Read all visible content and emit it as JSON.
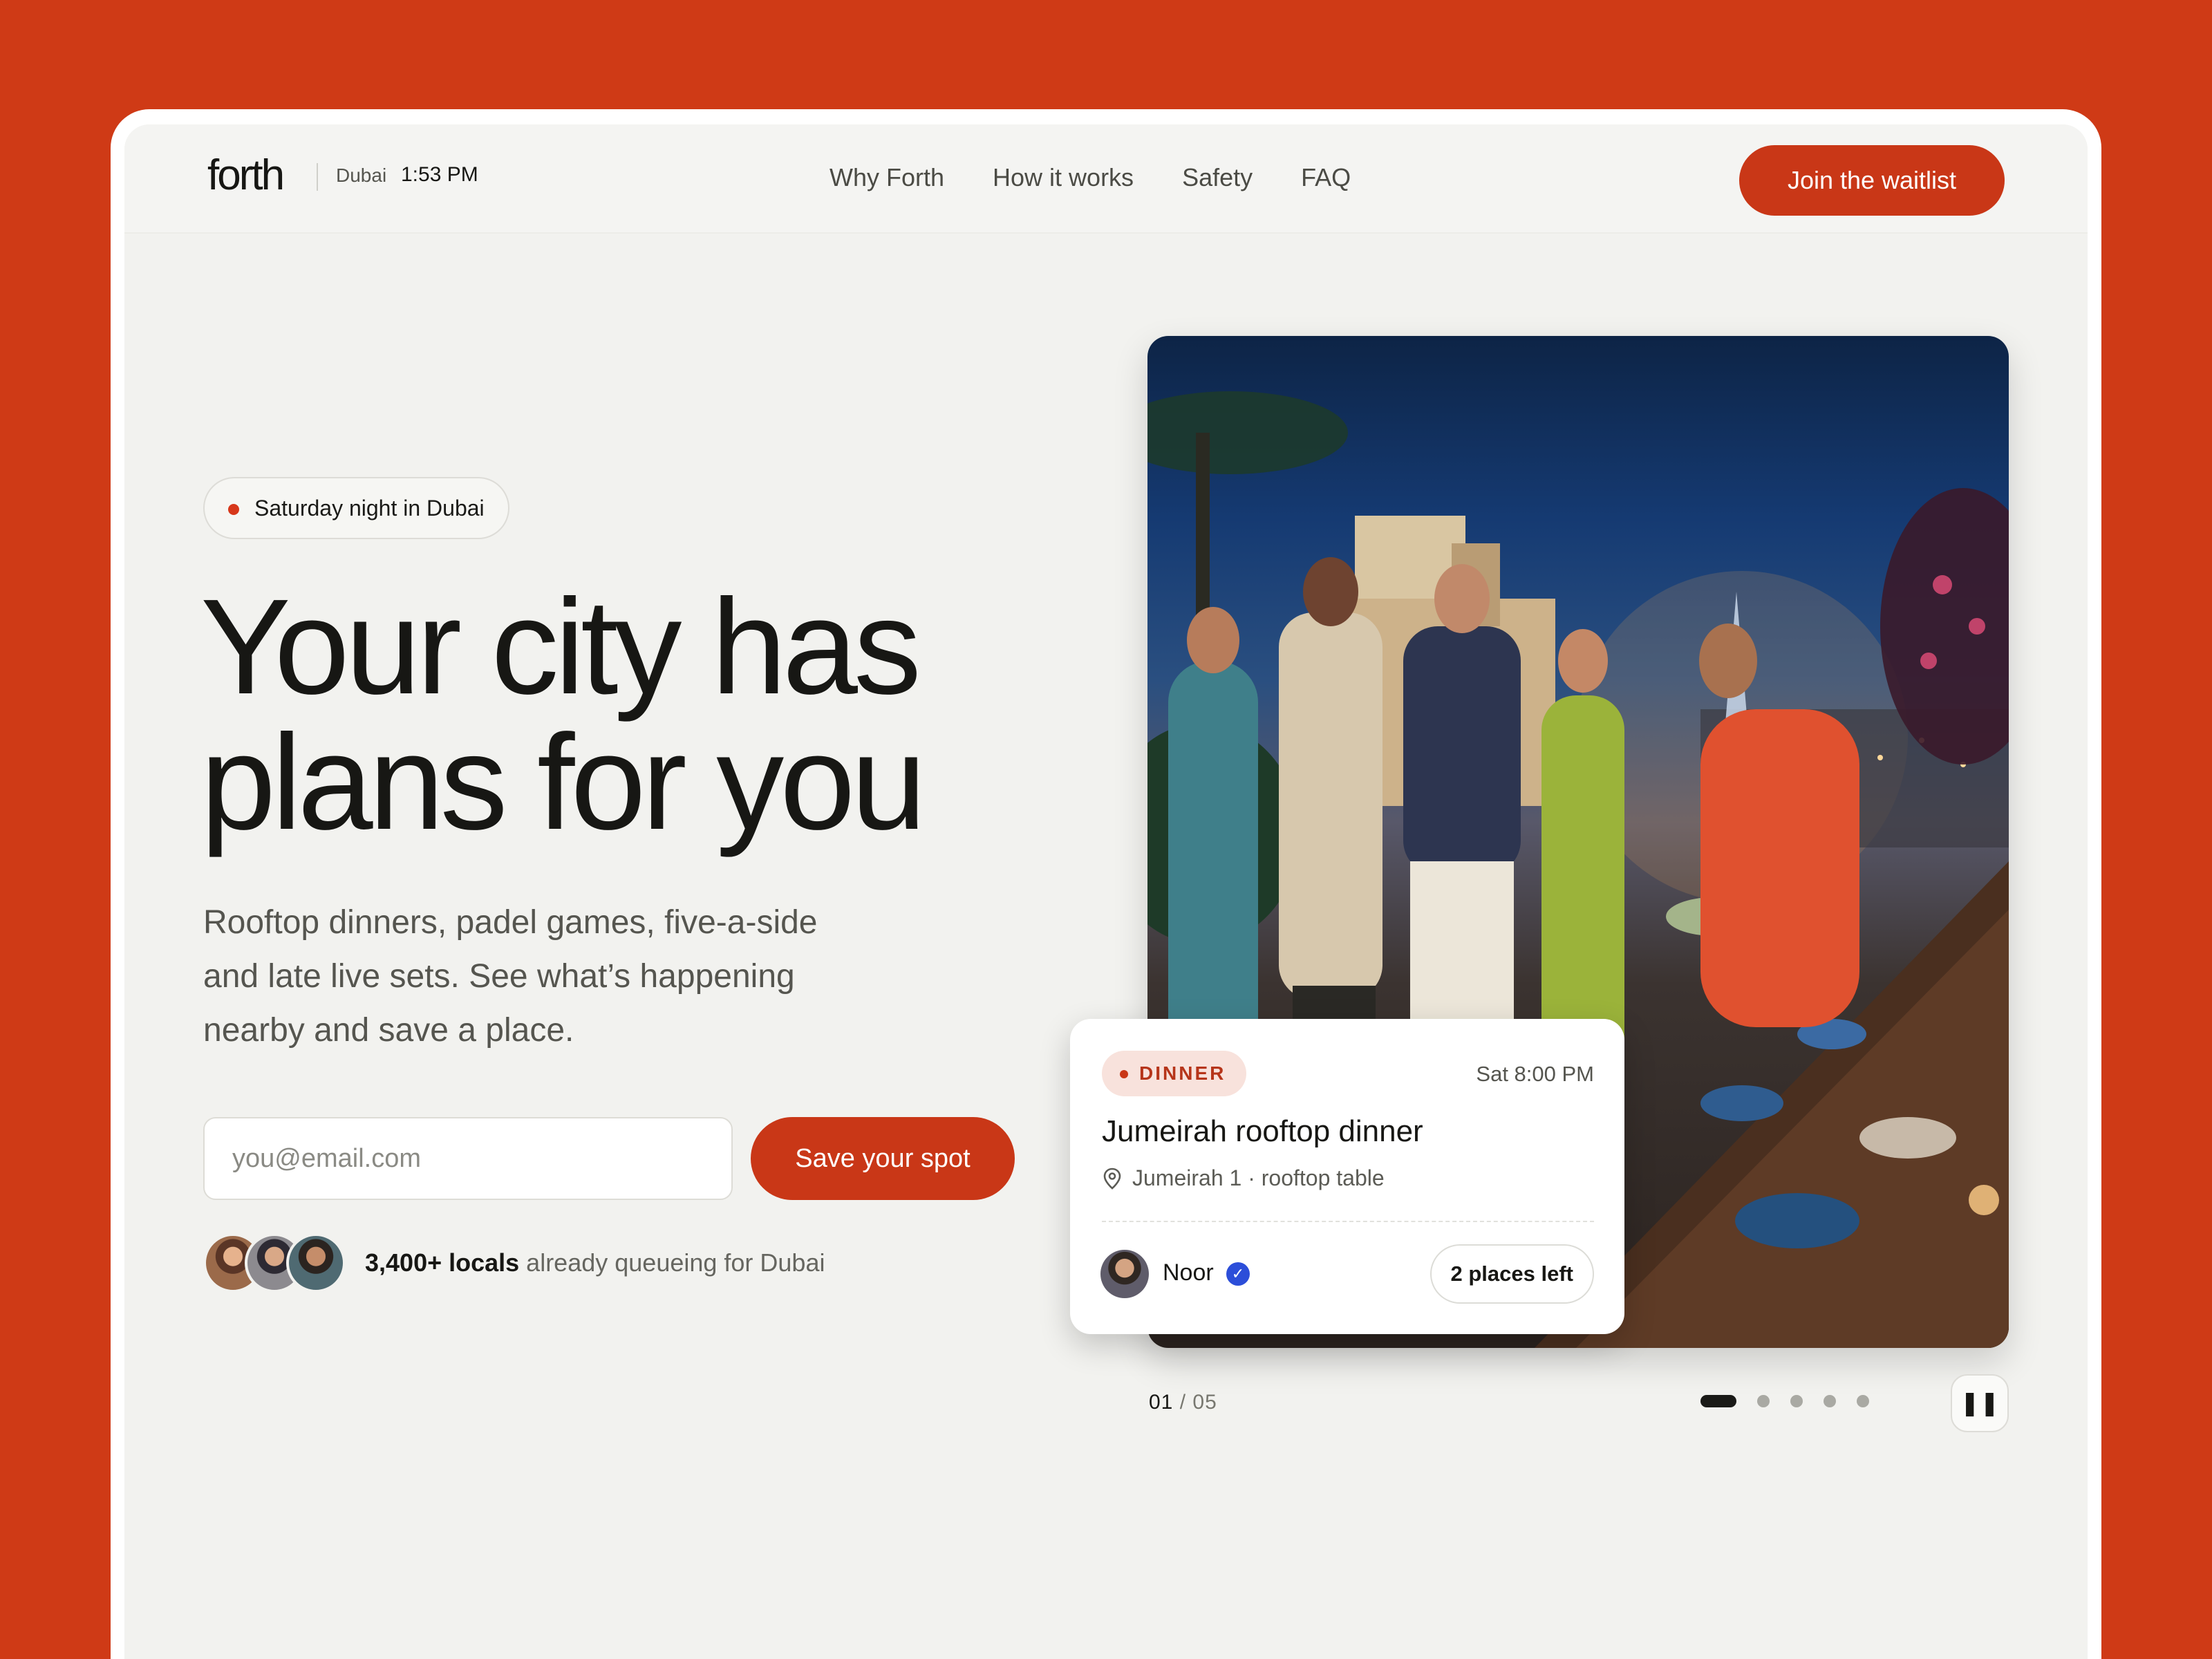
{
  "brand": {
    "logo": "forth",
    "city": "Dubai",
    "time": "1:53 PM"
  },
  "nav": {
    "items": [
      {
        "label": "Why Forth"
      },
      {
        "label": "How it works"
      },
      {
        "label": "Safety"
      },
      {
        "label": "FAQ"
      }
    ],
    "cta": "Join the waitlist"
  },
  "hero": {
    "pill": "Saturday night in Dubai",
    "headline_line1": "Your city has",
    "headline_line2": "plans for you",
    "subtitle": "Rooftop dinners, padel games, five-a-side and late live sets. See what’s happening nearby and save a place.",
    "email_placeholder": "you@email.com",
    "email_value": "",
    "save_button": "Save your spot",
    "locals_count": "3,400+ locals",
    "locals_text": " already queueing for Dubai"
  },
  "event_card": {
    "category": "DINNER",
    "time": "Sat 8:00 PM",
    "title": "Jumeirah rooftop dinner",
    "location": "Jumeirah 1 · rooftop table",
    "host": "Noor",
    "host_verified_icon": "check-badge-icon",
    "places": "2 places left"
  },
  "pager": {
    "current": "01",
    "total": "/ 05",
    "slides": 5,
    "active_index": 0
  },
  "colors": {
    "background": "#cf3a16",
    "accent": "#c93717",
    "page": "#f2f2ef",
    "verified": "#2c4ed9"
  }
}
